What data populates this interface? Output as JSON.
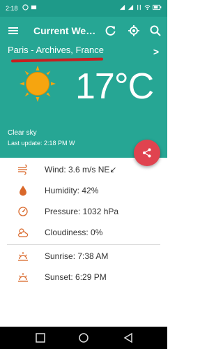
{
  "status_bar": {
    "time": "2:18"
  },
  "app_bar": {
    "title": "Current Weat...",
    "icons": [
      "menu-icon",
      "refresh-icon",
      "location-icon",
      "search-icon"
    ]
  },
  "weather": {
    "location": "Paris - Archives, France",
    "next_arrow": ">",
    "temperature": "17°C",
    "description": "Clear sky",
    "last_update": "Last update: 2:18 PM W"
  },
  "details": [
    {
      "icon": "wind-icon",
      "label": "Wind: 3.6 m/s NE↙"
    },
    {
      "icon": "humidity-icon",
      "label": "Humidity: 42%"
    },
    {
      "icon": "pressure-icon",
      "label": "Pressure: 1032 hPa"
    },
    {
      "icon": "cloudiness-icon",
      "label": "Cloudiness: 0%"
    },
    {
      "icon": "sunrise-icon",
      "label": "Sunrise: 7:38 AM"
    },
    {
      "icon": "sunset-icon",
      "label": "Sunset: 6:29 PM"
    }
  ],
  "colors": {
    "primary": "#26a694",
    "status_bar": "#1e9a89",
    "accent": "#e0434f",
    "icon_orange": "#d9682a",
    "sun": "#f6a50f"
  }
}
